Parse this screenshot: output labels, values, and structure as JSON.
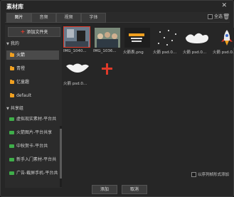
{
  "window": {
    "title": "素材库",
    "close": "✕"
  },
  "tabs": [
    {
      "label": "图片",
      "active": true
    },
    {
      "label": "音频",
      "active": false
    },
    {
      "label": "视频",
      "active": false
    },
    {
      "label": "字体",
      "active": false
    }
  ],
  "toolbar": {
    "select_all": "全选"
  },
  "sidebar": {
    "add_folder": "添加文件夹",
    "mine_section": "我的",
    "folders": [
      "火箭",
      "青橙",
      "忆童趣",
      "default"
    ],
    "shared_section": "共享组",
    "shared": [
      "虚拟现实素材-平台共",
      "火箭图片-平台共享",
      "中秋贺卡-平台共",
      "新手入门素材-平台共",
      "广告-截屏手机-平台共"
    ]
  },
  "assets": [
    {
      "label": "IMG_1040...",
      "kind": "photo-portrait",
      "selected": true
    },
    {
      "label": "IMG_1036...",
      "kind": "photo-group",
      "selected": false
    },
    {
      "label": "火箭表.png",
      "kind": "poster",
      "selected": false
    },
    {
      "label": "火箭 psd.0...",
      "kind": "stars",
      "selected": false
    },
    {
      "label": "火箭 psd.0...",
      "kind": "cloud",
      "selected": false
    },
    {
      "label": "火箭 psd.0...",
      "kind": "rocket",
      "selected": false
    },
    {
      "label": "火箭 psd.0...",
      "kind": "cloud2",
      "selected": false
    },
    {
      "label": "",
      "kind": "add",
      "selected": false
    }
  ],
  "footer": {
    "double_click_add": "以序列帧形式添加",
    "add": "添加",
    "cancel": "取消"
  },
  "colors": {
    "accent": "#e03a2a",
    "folder": "#f0a020",
    "shared": "#3fae4a"
  }
}
